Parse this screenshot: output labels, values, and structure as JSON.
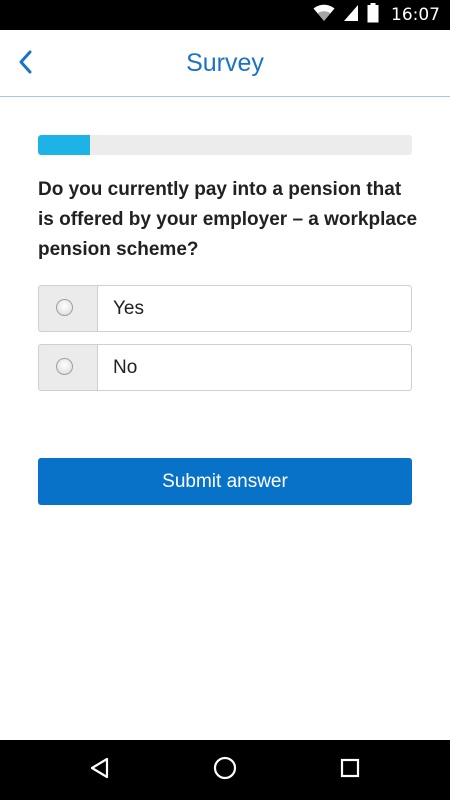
{
  "status_bar": {
    "time": "16:07",
    "icons": [
      "wifi-icon",
      "signal-icon",
      "battery-icon"
    ]
  },
  "app_bar": {
    "title": "Survey",
    "back_icon": "chevron-left-icon"
  },
  "progress": {
    "fraction": 0.14,
    "color": "#1eb3e6"
  },
  "question": {
    "text": "Do you currently pay into a pension that is offered by your employer – a workplace pension scheme?"
  },
  "options": [
    {
      "label": "Yes",
      "selected": false
    },
    {
      "label": "No",
      "selected": false
    }
  ],
  "submit": {
    "label": "Submit answer",
    "color": "#0872c8"
  },
  "nav_bar": {
    "icons": [
      "back-triangle-icon",
      "home-circle-icon",
      "recents-square-icon"
    ]
  },
  "colors": {
    "accent": "#1a73c4",
    "divider": "#a9c7e3"
  }
}
